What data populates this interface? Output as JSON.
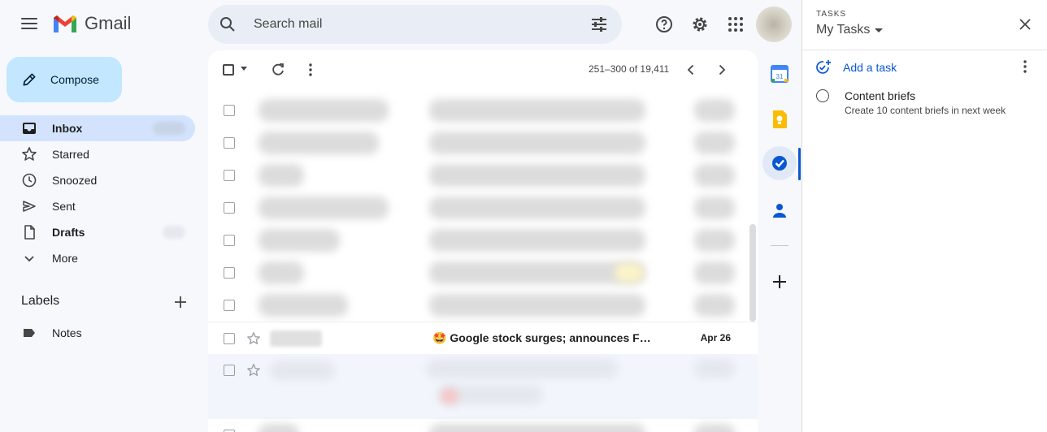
{
  "app": {
    "name": "Gmail"
  },
  "search": {
    "placeholder": "Search mail"
  },
  "compose": {
    "label": "Compose"
  },
  "nav": {
    "items": [
      {
        "label": "Inbox",
        "icon": "inbox-icon",
        "active": true,
        "bold": true
      },
      {
        "label": "Starred",
        "icon": "star-icon"
      },
      {
        "label": "Snoozed",
        "icon": "clock-icon"
      },
      {
        "label": "Sent",
        "icon": "send-icon"
      },
      {
        "label": "Drafts",
        "icon": "draft-icon",
        "bold": true
      },
      {
        "label": "More",
        "icon": "chevron-down-icon"
      }
    ]
  },
  "labels": {
    "title": "Labels",
    "items": [
      {
        "label": "Notes",
        "icon": "label-icon"
      }
    ]
  },
  "toolbar": {
    "pager": "251–300 of 19,411"
  },
  "emails": {
    "visible": [
      {
        "subject": "🤩 Google stock surges; announces FI...",
        "date": "Apr 26",
        "unread": true
      }
    ]
  },
  "side_apps": [
    "calendar-icon",
    "keep-icon",
    "tasks-icon",
    "contacts-icon",
    "add-icon"
  ],
  "tasks": {
    "kicker": "TASKS",
    "list_name": "My Tasks",
    "add_label": "Add a task",
    "items": [
      {
        "title": "Content briefs",
        "notes": "Create 10 content briefs in next week"
      }
    ]
  },
  "colors": {
    "background": "#f6f8fc",
    "compose": "#c2e7ff",
    "nav_active": "#d3e3fd",
    "accent": "#0b57d0",
    "search_bg": "#e9eef6"
  }
}
